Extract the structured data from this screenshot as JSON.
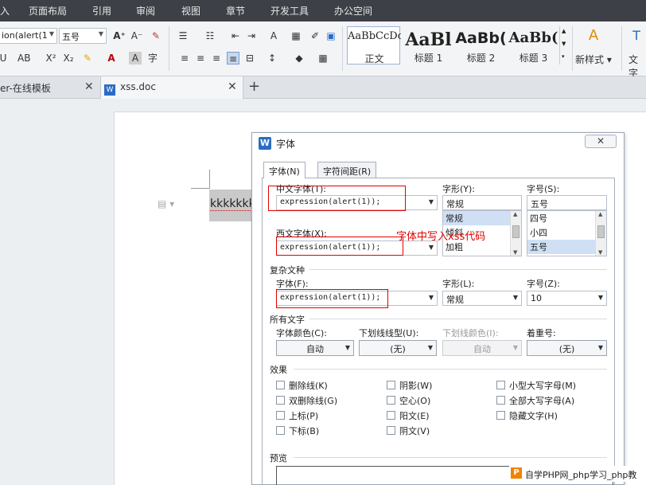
{
  "menubar": {
    "items": [
      "入",
      "页面布局",
      "引用",
      "审阅",
      "视图",
      "章节",
      "开发工具",
      "办公空间"
    ]
  },
  "ribbon": {
    "font_name": "ion(alert(1",
    "font_size": "五号",
    "styles": [
      {
        "sample": "AaBbCcDc",
        "caption": "正文"
      },
      {
        "sample": "AaBl",
        "caption": "标题 1"
      },
      {
        "sample": "AaBb(",
        "caption": "标题 2"
      },
      {
        "sample": "AaBb(",
        "caption": "标题 3"
      }
    ],
    "new_style_label": "新样式",
    "text_tools_label": "文字"
  },
  "tabs": {
    "left_tab_label": "er-在线模板",
    "doc_tab_label": "xss.doc",
    "add_label": "+"
  },
  "document": {
    "selected_text": "kkkkkkkk"
  },
  "dialog": {
    "title": "字体",
    "close_label": "✕",
    "tab_font": "字体(N)",
    "tab_spacing": "字符间距(R)",
    "cn_font_label": "中文字体(T):",
    "cn_font_value": "expression(alert(1));",
    "style_label": "字形(Y):",
    "style_value": "常规",
    "style_options": [
      "常规",
      "倾斜",
      "加粗"
    ],
    "size_label": "字号(S):",
    "size_value": "五号",
    "size_options": [
      "四号",
      "小四",
      "五号"
    ],
    "west_font_label": "西文字体(X):",
    "west_font_value": "expression(alert(1));",
    "complex_section": "复杂文种",
    "complex_font_label": "字体(F):",
    "complex_font_value": "expression(alert(1));",
    "complex_style_label": "字形(L):",
    "complex_style_value": "常规",
    "complex_size_label": "字号(Z):",
    "complex_size_value": "10",
    "all_text_section": "所有文字",
    "font_color_label": "字体颜色(C):",
    "font_color_value": "自动",
    "underline_label": "下划线线型(U):",
    "underline_value": "(无)",
    "underline_color_label": "下划线颜色(I):",
    "underline_color_value": "自动",
    "emphasis_label": "着重号:",
    "emphasis_value": "(无)",
    "effects_section": "效果",
    "effects": [
      "删除线(K)",
      "阴影(W)",
      "小型大写字母(M)",
      "双删除线(G)",
      "空心(O)",
      "全部大写字母(A)",
      "上标(P)",
      "阳文(E)",
      "隐藏文字(H)",
      "下标(B)",
      "阴文(V)"
    ],
    "preview_section": "预览"
  },
  "annotation": {
    "text": "字体中写入xss代码",
    "color": "#e00000"
  },
  "watermark": {
    "logo": "P",
    "text": "自学PHP网_php学习_php教"
  }
}
